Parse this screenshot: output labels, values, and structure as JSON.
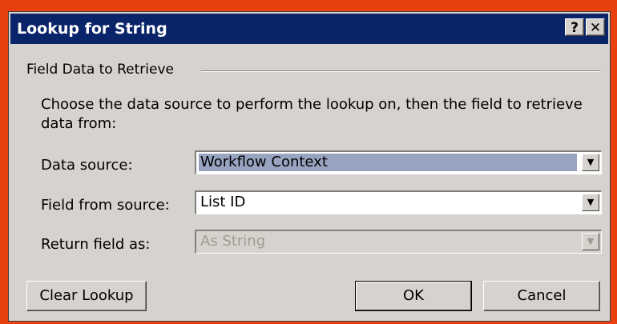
{
  "dialog": {
    "title": "Lookup for String",
    "help_symbol": "?",
    "close_symbol": "✕"
  },
  "group": {
    "label": "Field Data to Retrieve",
    "instructions": "Choose the data source to perform the lookup on, then the field to retrieve data from:"
  },
  "fields": {
    "data_source": {
      "label": "Data source:",
      "value": "Workflow Context",
      "arrow": "▼"
    },
    "field_from_source": {
      "label": "Field from source:",
      "value": "List ID",
      "arrow": "▼"
    },
    "return_field_as": {
      "label": "Return field as:",
      "value": "As String",
      "arrow": "▼",
      "disabled": true
    }
  },
  "buttons": {
    "clear_lookup": "Clear Lookup",
    "ok": "OK",
    "cancel": "Cancel"
  },
  "colors": {
    "background": "#e8410f",
    "titlebar": "#0a246a",
    "dialog": "#d6d3ce",
    "selection": "#98a4c0"
  }
}
